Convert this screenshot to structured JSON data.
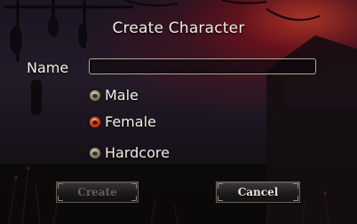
{
  "dialog": {
    "title": "Create Character"
  },
  "name_field": {
    "label": "Name",
    "value": "",
    "placeholder": ""
  },
  "options": [
    {
      "label": "Male",
      "selected": false
    },
    {
      "label": "Female",
      "selected": true
    },
    {
      "label": "Hardcore",
      "selected": false
    }
  ],
  "buttons": {
    "create_label": "Create",
    "create_enabled": false,
    "cancel_label": "Cancel"
  },
  "colors": {
    "text": "#f2efe8",
    "selected_radio": "#e0542a",
    "sky_glow": "#c81e1e"
  }
}
